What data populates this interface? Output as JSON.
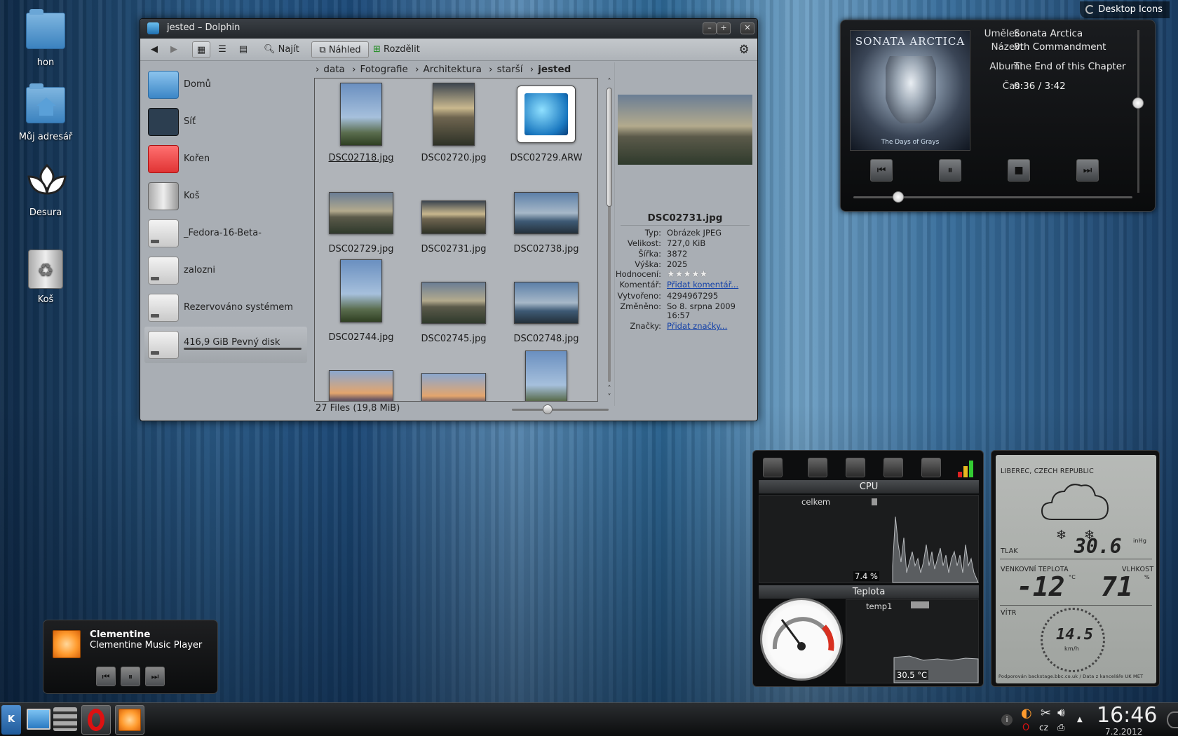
{
  "desktop": {
    "icons": [
      {
        "label": "hon",
        "icon": "folder-icon"
      },
      {
        "label": "Můj adresář",
        "icon": "home-folder-icon"
      },
      {
        "label": "Desura",
        "icon": "desura-icon"
      },
      {
        "label": "Koš",
        "icon": "trash-icon"
      }
    ],
    "desktop_icons_button": "Desktop Icons"
  },
  "dolphin": {
    "title": "jested – Dolphin",
    "toolbar": {
      "find_label": "Najít",
      "preview_label": "Náhled",
      "split_label": "Rozdělit"
    },
    "places": [
      {
        "label": "Domů",
        "icon": "home-icon"
      },
      {
        "label": "Síť",
        "icon": "network-icon"
      },
      {
        "label": "Kořen",
        "icon": "root-folder-icon"
      },
      {
        "label": "Koš",
        "icon": "trash-icon"
      },
      {
        "label": "_Fedora-16-Beta-",
        "icon": "drive-icon"
      },
      {
        "label": "zalozni",
        "icon": "drive-icon"
      },
      {
        "label": "Rezervováno systémem",
        "icon": "drive-icon"
      },
      {
        "label": "416,9 GiB Pevný disk",
        "icon": "drive-icon"
      }
    ],
    "breadcrumb": [
      "data",
      "Fotografie",
      "Architektura",
      "starší",
      "jested"
    ],
    "files": [
      {
        "name": "DSC02718.jpg"
      },
      {
        "name": "DSC02720.jpg"
      },
      {
        "name": "DSC02729.ARW"
      },
      {
        "name": "DSC02729.jpg"
      },
      {
        "name": "DSC02731.jpg"
      },
      {
        "name": "DSC02738.jpg"
      },
      {
        "name": "DSC02744.jpg"
      },
      {
        "name": "DSC02745.jpg"
      },
      {
        "name": "DSC02748.jpg"
      }
    ],
    "status": "27 Files (19,8 MiB)",
    "info_panel": {
      "filename": "DSC02731.jpg",
      "rows": [
        {
          "key": "Typ:",
          "value": "Obrázek JPEG"
        },
        {
          "key": "Velikost:",
          "value": "727,0 KiB"
        },
        {
          "key": "Šířka:",
          "value": "3872"
        },
        {
          "key": "Výška:",
          "value": "2025"
        },
        {
          "key": "Hodnocení:",
          "value": "★★★★★"
        },
        {
          "key": "Komentář:",
          "value": "Přidat komentář..."
        },
        {
          "key": "Vytvořeno:",
          "value": "4294967295"
        },
        {
          "key": "Změněno:",
          "value": "So 8. srpna 2009"
        },
        {
          "key": "",
          "value": "16:57"
        },
        {
          "key": "Značky:",
          "value": "Přidat značky..."
        }
      ]
    }
  },
  "now_playing": {
    "album_art_band": "SONATA ARCTICA",
    "album_art_title": "The Days of Grays",
    "labels": {
      "artist": "Umělec:",
      "title": "Název:",
      "album": "Album:",
      "time": "Čas:"
    },
    "artist": "Sonata Arctica",
    "title": "8th Commandment",
    "album": "The End of this Chapter",
    "time": "0:36 / 3:42",
    "progress": 0.16,
    "volume": 0.55
  },
  "clementine": {
    "title": "Clementine",
    "subtitle": "Clementine Music Player"
  },
  "system_monitor": {
    "cpu_header": "CPU",
    "cpu_label": "celkem",
    "cpu_value": "7.4 %",
    "temp_header": "Teplota",
    "temp_label": "temp1",
    "temp_value": "30.5 °C"
  },
  "weather": {
    "location": "LIBEREC, CZECH REPUBLIC",
    "pressure_label": "TLAK",
    "pressure_value": "30.6",
    "pressure_unit": "inHg",
    "temp_label": "VENKOVNÍ TEPLOTA",
    "temp_value": "-12",
    "temp_unit": "°C",
    "humidity_label": "VLHKOST",
    "humidity_value": "71",
    "humidity_unit": "%",
    "wind_label": "VÍTR",
    "wind_value": "14.5",
    "wind_unit": "km/h",
    "credit": "Podporován backstage.bbc.co.uk / Data z kanceláře UK MET"
  },
  "taskbar": {
    "keyboard_layout": "cz",
    "time": "16:46",
    "date": "7.2.2012"
  },
  "colors": {
    "accent_link": "#1240a8",
    "clementine_orange": "#ff9b2e"
  }
}
